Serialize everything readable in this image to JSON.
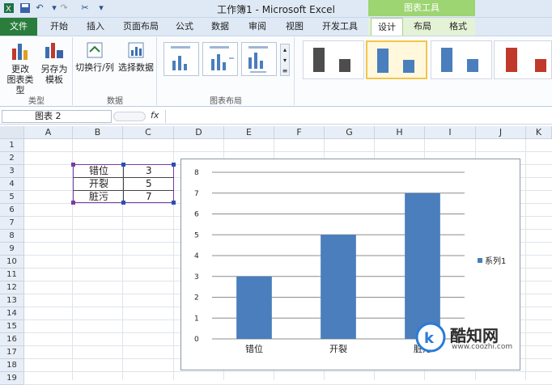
{
  "window": {
    "title": "工作簿1 - Microsoft Excel",
    "context_tab_group": "图表工具"
  },
  "tabs": [
    "文件",
    "开始",
    "插入",
    "页面布局",
    "公式",
    "数据",
    "审阅",
    "视图",
    "开发工具",
    "设计",
    "布局",
    "格式"
  ],
  "ribbon": {
    "groups": [
      {
        "label": "类型",
        "buttons": [
          "更改\n图表类型",
          "另存为\n模板"
        ]
      },
      {
        "label": "数据",
        "buttons": [
          "切换行/列",
          "选择数据"
        ]
      },
      {
        "label": "图表布局"
      }
    ]
  },
  "formula": {
    "name_box": "图表 2",
    "fx": "fx"
  },
  "columns": [
    "A",
    "B",
    "C",
    "D",
    "E",
    "F",
    "G",
    "H",
    "I",
    "J",
    "K"
  ],
  "rows": [
    "1",
    "2",
    "3",
    "4",
    "5",
    "6",
    "7",
    "8",
    "9",
    "10",
    "11",
    "12",
    "13",
    "14",
    "15",
    "16",
    "17",
    "18",
    "19"
  ],
  "cells": [
    {
      "label": "错位",
      "value": "3"
    },
    {
      "label": "开裂",
      "value": "5"
    },
    {
      "label": "脏污",
      "value": "7"
    }
  ],
  "chart_data": {
    "type": "bar",
    "categories": [
      "错位",
      "开裂",
      "脏污"
    ],
    "series": [
      {
        "name": "系列1",
        "values": [
          3,
          5,
          7
        ]
      }
    ],
    "ylim": [
      0,
      8
    ],
    "yticks": [
      0,
      1,
      2,
      3,
      4,
      5,
      6,
      7,
      8
    ],
    "grid": true,
    "legend": "right",
    "colors": {
      "bar": "#4a7ebc"
    }
  },
  "watermark": {
    "name": "酷知网",
    "url": "www.coozhi.com"
  }
}
